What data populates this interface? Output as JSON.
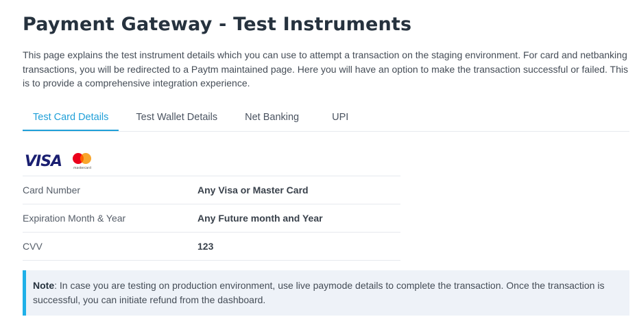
{
  "page": {
    "title": "Payment Gateway - Test Instruments",
    "intro": "This page explains the test instrument details which you can use to attempt a transaction on the staging environment. For card and netbanking transactions, you will be redirected to a Paytm maintained page. Here you will have an option to make the transaction successful or failed. This is to provide a comprehensive integration experience."
  },
  "tabs": [
    {
      "label": "Test Card Details",
      "active": true
    },
    {
      "label": "Test Wallet Details",
      "active": false
    },
    {
      "label": "Net Banking",
      "active": false
    },
    {
      "label": "UPI",
      "active": false
    }
  ],
  "logo": {
    "visa_text": "VISA",
    "mastercard_text": "mastercard"
  },
  "card_details": [
    {
      "label": "Card Number",
      "value": "Any Visa or Master Card"
    },
    {
      "label": "Expiration Month & Year",
      "value": "Any Future month and Year"
    },
    {
      "label": "CVV",
      "value": "123"
    }
  ],
  "note": {
    "label": "Note",
    "text": ": In case you are testing on production environment, use live paymode details to complete the transaction. Once the transaction is successful, you can initiate refund from the dashboard."
  },
  "colors": {
    "accent": "#1f9fd8",
    "note_border": "#1fb0e8",
    "visa_blue": "#1a1f71",
    "mc_red": "#eb001b",
    "mc_orange": "#f79e1b"
  }
}
